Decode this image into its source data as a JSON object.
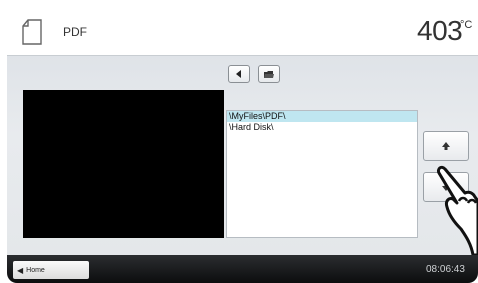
{
  "header": {
    "title": "PDF",
    "temperature": "403",
    "temperature_unit": "°C"
  },
  "toolbar": {
    "icons": [
      "back-arrow-icon",
      "open-folder-icon"
    ]
  },
  "file_list": {
    "items": [
      "\\MyFiles\\PDF\\",
      "\\Hard Disk\\"
    ],
    "selected_index": 0
  },
  "side_buttons": {
    "icons": [
      "arrow-up-icon",
      "arrow-down-icon"
    ]
  },
  "footer": {
    "home_label": "Home",
    "time": "08:06:43"
  },
  "colors": {
    "selection": "#bfe6f0",
    "panel": "#e2e6ea",
    "footer": "#1a1b1d"
  }
}
